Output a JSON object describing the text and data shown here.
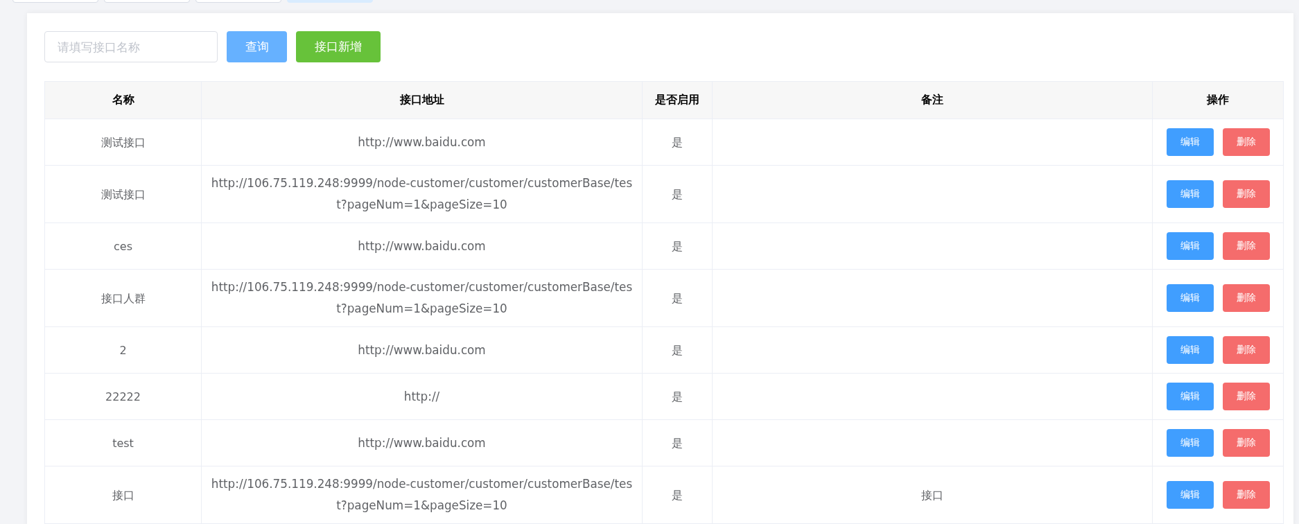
{
  "tabs": [
    {
      "selected": false
    },
    {
      "selected": false
    },
    {
      "selected": false
    },
    {
      "selected": true
    }
  ],
  "toolbar": {
    "search": {
      "placeholder": "请填写接口名称"
    },
    "buttons": [
      {
        "label": "查询",
        "kind": "query"
      },
      {
        "label": "接口新增",
        "kind": "add"
      }
    ]
  },
  "table": {
    "columns": [
      "名称",
      "接口地址",
      "是否启用",
      "备注",
      "操作"
    ],
    "rows": [
      {
        "name": "测试接口",
        "url": "http://www.baidu.com",
        "enabled": "是",
        "actions": [
          "编辑",
          "删除"
        ]
      },
      {
        "name": "测试接口",
        "url": "http://106.75.119.248:9999/node-customer/customer/customerBase/test?pageNum=1&pageSize=10",
        "enabled": "是",
        "actions": [
          "编辑",
          "删除"
        ]
      },
      {
        "name": "ces",
        "url": "http://www.baidu.com",
        "enabled": "是",
        "actions": [
          "编辑",
          "删除"
        ]
      },
      {
        "name": "接口人群",
        "url": "http://106.75.119.248:9999/node-customer/customer/customerBase/test?pageNum=1&pageSize=10",
        "enabled": "是",
        "actions": [
          "编辑",
          "删除"
        ]
      },
      {
        "name": "2",
        "url": "http://www.baidu.com",
        "enabled": "是",
        "actions": [
          "编辑",
          "删除"
        ]
      },
      {
        "name": "22222",
        "url": "http://",
        "enabled": "是",
        "actions": [
          "编辑",
          "删除"
        ]
      },
      {
        "name": "test",
        "url": "http://www.baidu.com",
        "enabled": "是",
        "actions": [
          "编辑",
          "删除"
        ]
      },
      {
        "name": "接口",
        "url": "http://106.75.119.248:9999/node-customer/customer/customerBase/test?pageNum=1&pageSize=10",
        "enabled": "是",
        "remark": "接口",
        "actions": [
          "编辑",
          "删除"
        ]
      }
    ]
  }
}
